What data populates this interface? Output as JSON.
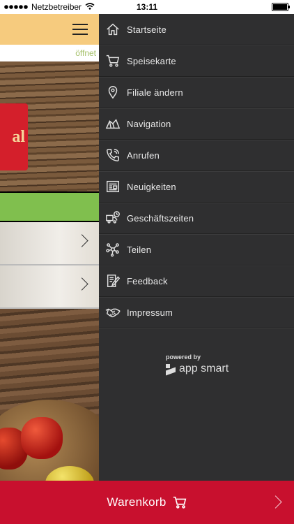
{
  "status_bar": {
    "carrier": "Netzbetreiber",
    "time": "13:11",
    "battery_level": 1.0
  },
  "app": {
    "status_text": "öffnet",
    "logo_fragment": "al"
  },
  "menu": {
    "items": [
      {
        "label": "Startseite",
        "icon": "home-icon"
      },
      {
        "label": "Speisekarte",
        "icon": "cart-icon"
      },
      {
        "label": "Filiale ändern",
        "icon": "location-pin-icon"
      },
      {
        "label": "Navigation",
        "icon": "map-icon"
      },
      {
        "label": "Anrufen",
        "icon": "phone-icon"
      },
      {
        "label": "Neuigkeiten",
        "icon": "newspaper-icon"
      },
      {
        "label": "Geschäftszeiten",
        "icon": "delivery-clock-icon"
      },
      {
        "label": "Teilen",
        "icon": "share-icon"
      },
      {
        "label": "Feedback",
        "icon": "feedback-icon"
      },
      {
        "label": "Impressum",
        "icon": "handshake-icon"
      }
    ],
    "powered_by": "powered by",
    "brand": "app smart"
  },
  "cart": {
    "label": "Warenkorb"
  },
  "colors": {
    "menu_bg": "#2f2f30",
    "cart_bar": "#c8102e",
    "header": "#f6cb7e",
    "green": "#80bf4e"
  }
}
